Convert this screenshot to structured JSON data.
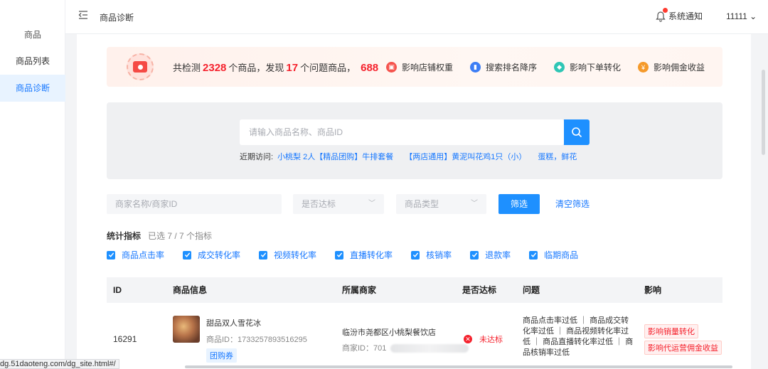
{
  "sidebar": {
    "group": "商品",
    "items": [
      {
        "label": "商品列表",
        "active": false
      },
      {
        "label": "商品诊断",
        "active": true
      }
    ]
  },
  "header": {
    "collapse_icon": "menu-fold-icon",
    "breadcrumb": "商品诊断",
    "notify_label": "系统通知",
    "user": "11111 ⌄"
  },
  "banner": {
    "prefix": "共检测",
    "total": "2328",
    "mid": "个商品，发现",
    "issues": "17",
    "suffix": "个问题商品，",
    "extra": "688",
    "impacts": [
      {
        "label": "影响店铺权重",
        "color": "#f5544e",
        "icon": "▣"
      },
      {
        "label": "搜索排名降序",
        "color": "#3d7ef5",
        "icon": "▮"
      },
      {
        "label": "影响下单转化",
        "color": "#2fc6b5",
        "icon": "◆"
      },
      {
        "label": "影响佣金收益",
        "color": "#f59a2b",
        "icon": "¥"
      }
    ]
  },
  "search": {
    "placeholder": "请输入商品名称、商品ID",
    "recent_label": "近期访问:",
    "recent": [
      "小桃梨 2人【精品团购】牛排套餐",
      "【两店通用】黄泥叫花鸡1只（小）",
      "蛋糕，鲜花"
    ]
  },
  "filters": {
    "merchant_placeholder": "商家名称/商家ID",
    "standard_placeholder": "是否达标",
    "type_placeholder": "商品类型",
    "filter_btn": "筛选",
    "clear_btn": "清空筛选"
  },
  "metrics": {
    "title": "统计指标",
    "selected": "已选 7 / 7 个指标",
    "items": [
      "商品点击率",
      "成交转化率",
      "视频转化率",
      "直播转化率",
      "核销率",
      "退款率",
      "临期商品"
    ]
  },
  "table": {
    "headers": [
      "ID",
      "商品信息",
      "所属商家",
      "是否达标",
      "问题",
      "影响"
    ],
    "rows": [
      {
        "id": "16291",
        "name": "甜品双人雪花冰",
        "product_id": "商品ID：1733257893516295",
        "tag": "团购券",
        "merchant": "临汾市尧都区小桃梨餐饮店",
        "merchant_id": "商家ID：701",
        "status": "未达标",
        "issue": "商品点击率过低 ｜ 商品成交转化率过低 ｜ 商品视频转化率过低 ｜ 商品直播转化率过低 ｜ 商品核销率过低",
        "impacts": [
          "影响销量转化",
          "影响代运营佣金收益"
        ]
      }
    ]
  },
  "statusbar": "dg.51daoteng.com/dg_site.html#/"
}
